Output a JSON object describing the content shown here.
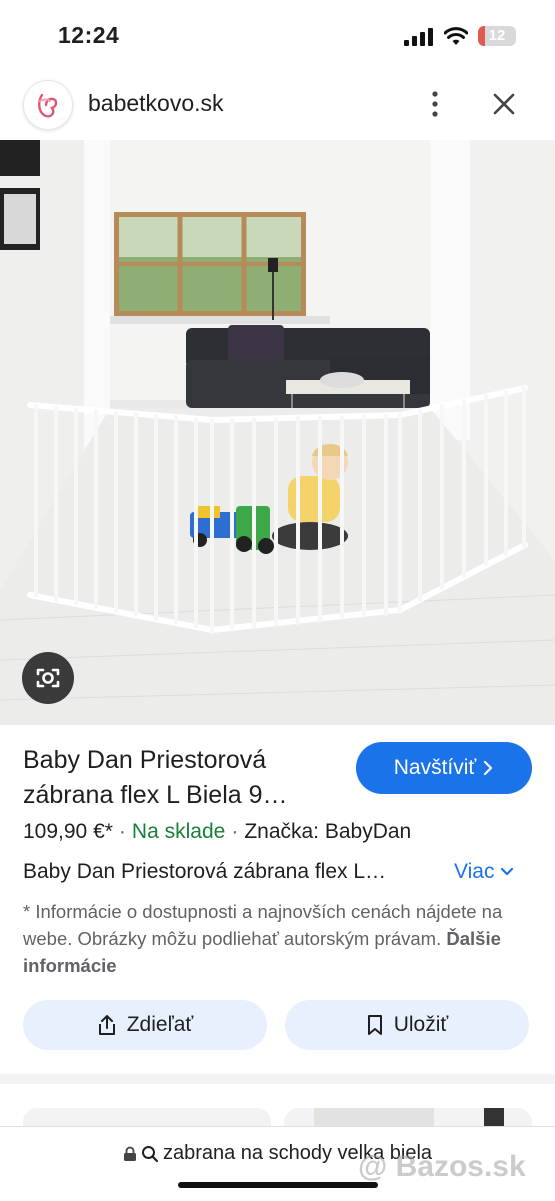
{
  "status_bar": {
    "time": "12:24",
    "battery_level": "12",
    "battery_color": "#e05b4f"
  },
  "site": {
    "name": "babetkovo.sk"
  },
  "product": {
    "title": "Baby Dan Priestorová zábrana flex L Biela 9…",
    "visit_label": "Navštíviť",
    "price": "109,90 €*",
    "availability": "Na sklade",
    "brand": "Značka: BabyDan",
    "description": "Baby Dan Priestorová zábrana flex L…",
    "more_label": "Viac",
    "disclaimer": "* Informácie o dostupnosti a najnovších cenách nájdete na webe. Obrázky môžu podliehať autorským právam.",
    "more_info_label": "Ďalšie informácie"
  },
  "actions": {
    "share_label": "Zdieľať",
    "save_label": "Uložiť"
  },
  "url_bar": {
    "query": "zabrana na schody velka biela"
  },
  "watermark": "@ Bazos.sk",
  "colors": {
    "accent": "#1a73e8",
    "in_stock": "#188038",
    "button_bg": "#e8f0fe"
  },
  "icons": [
    "signal-icon",
    "wifi-icon",
    "battery-icon",
    "site-logo-icon",
    "more-vert-icon",
    "close-icon",
    "lens-icon",
    "chevron-right-icon",
    "chevron-down-icon",
    "share-icon",
    "bookmark-icon",
    "lock-icon",
    "search-icon"
  ]
}
